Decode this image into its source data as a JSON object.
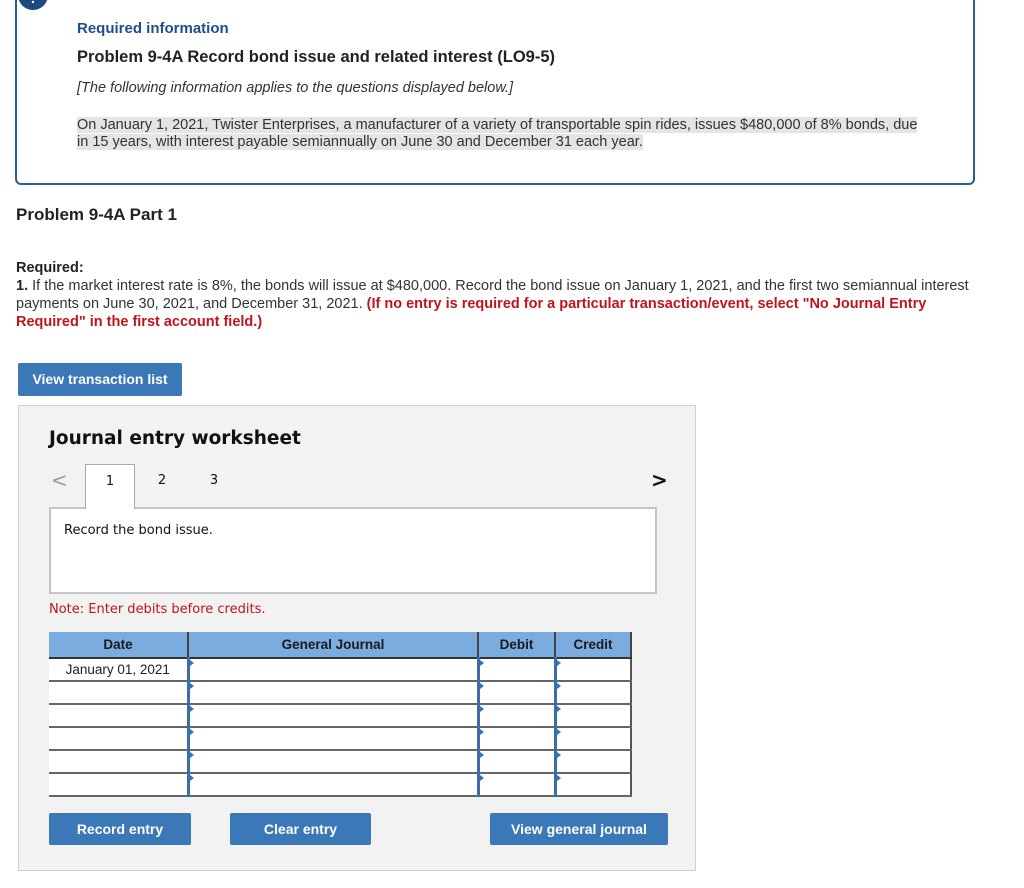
{
  "info": {
    "alert_glyph": "!",
    "label": "Required information",
    "title": "Problem 9-4A Record bond issue and related interest (LO9-5)",
    "italic_note": "[The following information applies to the questions displayed below.]",
    "paragraph": "On January 1, 2021, Twister Enterprises, a manufacturer of a variety of transportable spin rides, issues $480,000 of 8% bonds, due in 15 years, with interest payable semiannually on June 30 and December 31 each year."
  },
  "part": {
    "heading": "Problem 9-4A Part 1",
    "required_label": "Required:",
    "item_number": "1.",
    "item_text": " If the market interest rate is 8%, the bonds will issue at $480,000. Record the bond issue on January 1, 2021, and the first two semiannual interest payments on June 30, 2021, and December 31, 2021. ",
    "item_instruction": "(If no entry is required for a particular transaction/event, select \"No Journal Entry Required\" in the first account field.)"
  },
  "buttons": {
    "view_transaction_list": "View transaction list",
    "record_entry": "Record entry",
    "clear_entry": "Clear entry",
    "view_general_journal": "View general journal"
  },
  "worksheet": {
    "title": "Journal entry worksheet",
    "prev_icon": "chevron-left-icon",
    "next_icon": "chevron-right-icon",
    "prev_glyph": "<",
    "next_glyph": ">",
    "tabs": [
      {
        "label": "1",
        "active": true
      },
      {
        "label": "2",
        "active": false
      },
      {
        "label": "3",
        "active": false
      }
    ],
    "instruction": "Record the bond issue.",
    "note": "Note: Enter debits before credits."
  },
  "journal_table": {
    "headers": {
      "date": "Date",
      "general_journal": "General Journal",
      "debit": "Debit",
      "credit": "Credit"
    },
    "rows": [
      {
        "date": "January 01, 2021",
        "account": "",
        "debit": "",
        "credit": ""
      },
      {
        "date": "",
        "account": "",
        "debit": "",
        "credit": ""
      },
      {
        "date": "",
        "account": "",
        "debit": "",
        "credit": ""
      },
      {
        "date": "",
        "account": "",
        "debit": "",
        "credit": ""
      },
      {
        "date": "",
        "account": "",
        "debit": "",
        "credit": ""
      },
      {
        "date": "",
        "account": "",
        "debit": "",
        "credit": ""
      }
    ]
  },
  "colors": {
    "accent_blue": "#3a78b8",
    "info_border": "#2b5c94",
    "table_header": "#7aacdf",
    "warning_red": "#c0141c"
  }
}
